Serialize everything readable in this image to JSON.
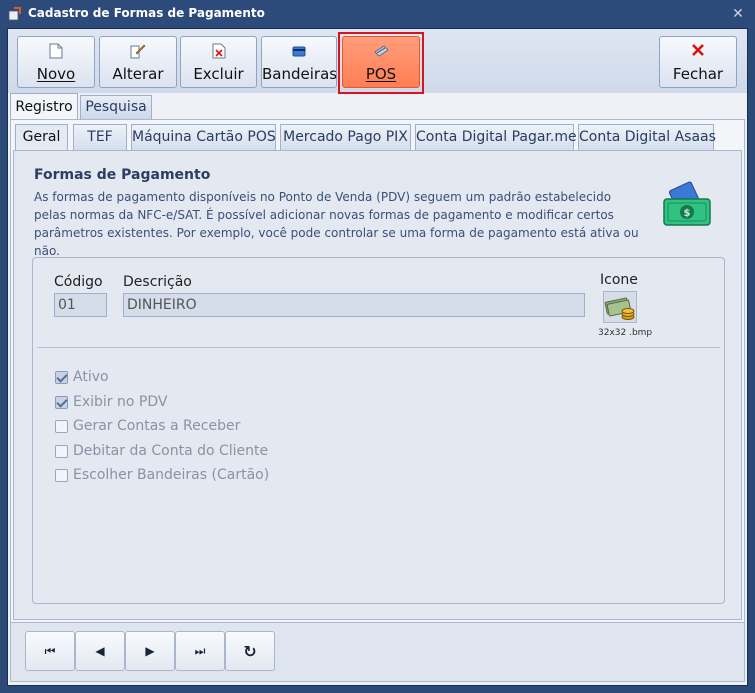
{
  "window": {
    "title": "Cadastro de Formas de Pagamento",
    "close_glyph": "✕"
  },
  "toolbar": {
    "buttons": [
      {
        "label": "Novo",
        "icon": "new-document-icon"
      },
      {
        "label": "Alterar",
        "icon": "edit-document-icon"
      },
      {
        "label": "Excluir",
        "icon": "delete-document-icon"
      },
      {
        "label": "Bandeiras",
        "icon": "card-icon"
      },
      {
        "label": "POS",
        "icon": "pos-terminal-icon"
      },
      {
        "label": "Fechar",
        "icon": "close-x-icon"
      }
    ],
    "highlight_color": "#d4141f",
    "pos_color": "#ff8a60"
  },
  "main_tabs": [
    "Registro",
    "Pesquisa"
  ],
  "sub_tabs": [
    "Geral",
    "TEF",
    "Máquina Cartão POS",
    "Mercado Pago PIX",
    "Conta Digital Pagar.me",
    "Conta Digital Asaas"
  ],
  "section": {
    "title": "Formas de Pagamento",
    "description": "As formas de pagamento disponíveis no Ponto de Venda (PDV) seguem um padrão estabelecido pelas normas da NFC-e/SAT. É possível adicionar novas formas de pagamento e modificar certos parâmetros existentes. Por exemplo, você pode controlar se uma forma de pagamento está ativa ou não."
  },
  "form": {
    "codigo_label": "Código",
    "codigo_value": "01",
    "descricao_label": "Descrição",
    "descricao_value": "DINHEIRO",
    "icone_label": "Icone",
    "icone_caption": "32x32 .bmp"
  },
  "checkboxes": [
    {
      "label": "Ativo",
      "checked": true
    },
    {
      "label": "Exibir no PDV",
      "checked": true
    },
    {
      "label": "Gerar Contas a Receber",
      "checked": false
    },
    {
      "label": "Debitar da Conta do Cliente",
      "checked": false
    },
    {
      "label": "Escolher Bandeiras (Cartão)",
      "checked": false
    }
  ],
  "nav": {
    "first": "⏮",
    "prev": "◀",
    "next": "▶",
    "last": "⏭",
    "refresh": "↻"
  }
}
